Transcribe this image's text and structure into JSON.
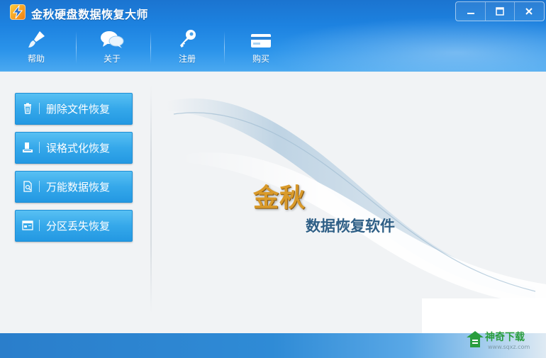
{
  "window": {
    "title": "金秋硬盘数据恢复大师"
  },
  "toolbar": [
    {
      "label": "帮助",
      "icon": "brush-icon"
    },
    {
      "label": "关于",
      "icon": "chat-bubbles-icon"
    },
    {
      "label": "注册",
      "icon": "key-icon"
    },
    {
      "label": "购买",
      "icon": "card-icon"
    }
  ],
  "menu": [
    {
      "label": "删除文件恢复",
      "icon": "trash-icon"
    },
    {
      "label": "误格式化恢复",
      "icon": "format-icon"
    },
    {
      "label": "万能数据恢复",
      "icon": "document-icon"
    },
    {
      "label": "分区丢失恢复",
      "icon": "partition-icon"
    }
  ],
  "banner": {
    "brand": "金秋",
    "subtitle": "数据恢复软件"
  },
  "watermark": {
    "text": "神奇下载",
    "url": "www.sqxz.com"
  },
  "colors": {
    "header": "#1d82e0",
    "menu_button": "#35a8ea",
    "brand_gold": "#d99a2a",
    "subtitle_blue": "#2f5f86"
  }
}
